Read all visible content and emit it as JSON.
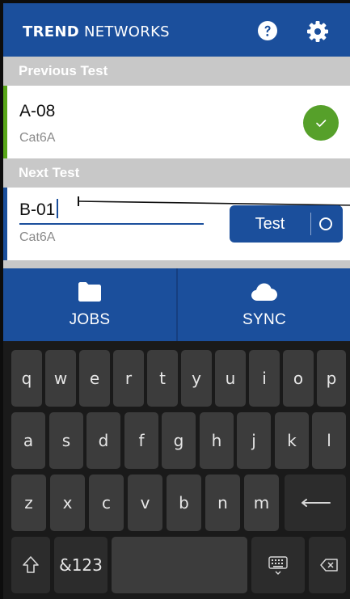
{
  "header": {
    "brand_bold": "TREND",
    "brand_rest": " NETWORKS",
    "help_icon": "question-circle-icon",
    "settings_icon": "gear-icon"
  },
  "previous_test": {
    "section_label": "Previous Test",
    "cable_id": "A-08",
    "cable_type": "Cat6A",
    "status_icon": "check-circle-icon",
    "status_color": "#56a02a"
  },
  "next_test": {
    "section_label": "Next Test",
    "cable_id": "B-01",
    "cable_type": "Cat6A",
    "test_button_label": "Test"
  },
  "nav": {
    "jobs_label": "JOBS",
    "sync_label": "SYNC"
  },
  "keyboard": {
    "row1": [
      "q",
      "w",
      "e",
      "r",
      "t",
      "y",
      "u",
      "i",
      "o",
      "p"
    ],
    "row2": [
      "a",
      "s",
      "d",
      "f",
      "g",
      "h",
      "j",
      "k",
      "l"
    ],
    "row3": [
      "z",
      "x",
      "c",
      "v",
      "b",
      "n",
      "m"
    ],
    "symbols_label": "&123"
  },
  "colors": {
    "brand_blue": "#1b4f9c",
    "section_gray": "#c8c8c8",
    "success_green": "#56a02a"
  }
}
